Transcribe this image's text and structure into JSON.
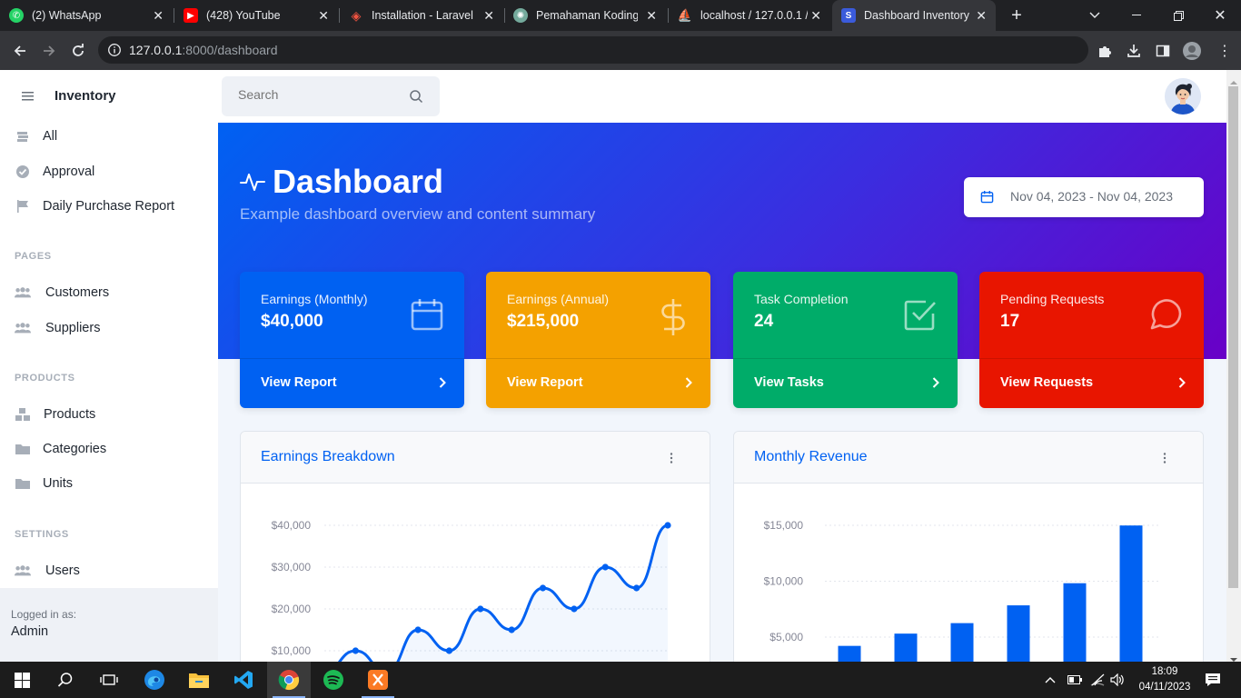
{
  "browser": {
    "tabs": [
      {
        "title": "(2) WhatsApp",
        "favicon": "whatsapp-icon",
        "color": "#25d366"
      },
      {
        "title": "(428) YouTube",
        "favicon": "youtube-icon",
        "color": "#ff0000"
      },
      {
        "title": "Installation - Laravel",
        "favicon": "laravel-icon",
        "color": "#f05340"
      },
      {
        "title": "Pemahaman Koding",
        "favicon": "openai-icon",
        "color": "#74aa9c"
      },
      {
        "title": "localhost / 127.0.0.1 /",
        "favicon": "phpmyadmin-icon",
        "color": "#f89c0e"
      },
      {
        "title": "Dashboard Inventory",
        "favicon": "dashboard-s-icon",
        "color": "#3b5bdb",
        "active": true
      }
    ],
    "url_host": "127.0.0.1",
    "url_path": ":8000/dashboard"
  },
  "app": {
    "brand": "Inventory",
    "search_placeholder": "Search"
  },
  "sidebar": {
    "top_items": [
      {
        "label": "All",
        "icon": "stack-icon"
      },
      {
        "label": "Approval",
        "icon": "check-circle-icon"
      },
      {
        "label": "Daily Purchase Report",
        "icon": "flag-icon"
      }
    ],
    "sections": [
      {
        "heading": "PAGES",
        "items": [
          {
            "label": "Customers",
            "icon": "users-icon"
          },
          {
            "label": "Suppliers",
            "icon": "users-icon"
          }
        ]
      },
      {
        "heading": "PRODUCTS",
        "items": [
          {
            "label": "Products",
            "icon": "boxes-icon"
          },
          {
            "label": "Categories",
            "icon": "folder-icon"
          },
          {
            "label": "Units",
            "icon": "folder-icon"
          }
        ]
      },
      {
        "heading": "SETTINGS",
        "items": [
          {
            "label": "Users",
            "icon": "users-icon"
          }
        ]
      }
    ],
    "footer": {
      "logged_in_label": "Logged in as:",
      "user": "Admin"
    }
  },
  "header": {
    "title": "Dashboard",
    "subtitle": "Example dashboard overview and content summary",
    "date_range": "Nov 04, 2023 - Nov 04, 2023"
  },
  "stats": [
    {
      "label": "Earnings (Monthly)",
      "value": "$40,000",
      "link": "View Report",
      "icon": "calendar-icon",
      "color": "#0061f2"
    },
    {
      "label": "Earnings (Annual)",
      "value": "$215,000",
      "link": "View Report",
      "icon": "dollar-icon",
      "color": "#f4a100"
    },
    {
      "label": "Task Completion",
      "value": "24",
      "link": "View Tasks",
      "icon": "check-square-icon",
      "color": "#00ac69"
    },
    {
      "label": "Pending Requests",
      "value": "17",
      "link": "View Requests",
      "icon": "message-circle-icon",
      "color": "#e81500"
    }
  ],
  "panels": {
    "earnings_title": "Earnings Breakdown",
    "revenue_title": "Monthly Revenue"
  },
  "chart_data": [
    {
      "type": "area",
      "title": "Earnings Breakdown",
      "y_ticks": [
        "$10,000",
        "$20,000",
        "$30,000",
        "$40,000"
      ],
      "values": [
        5000,
        10000,
        5000,
        15000,
        10000,
        20000,
        15000,
        25000,
        20000,
        30000,
        25000,
        40000
      ],
      "ylim": [
        0,
        40000
      ],
      "color": "#0061f2"
    },
    {
      "type": "bar",
      "title": "Monthly Revenue",
      "y_ticks": [
        "$5,000",
        "$10,000",
        "$15,000"
      ],
      "values": [
        4215,
        5312,
        6251,
        7841,
        9821,
        14984
      ],
      "ylim": [
        0,
        15000
      ],
      "color": "#0061f2"
    }
  ],
  "taskbar": {
    "time": "18:09",
    "date": "04/11/2023"
  }
}
